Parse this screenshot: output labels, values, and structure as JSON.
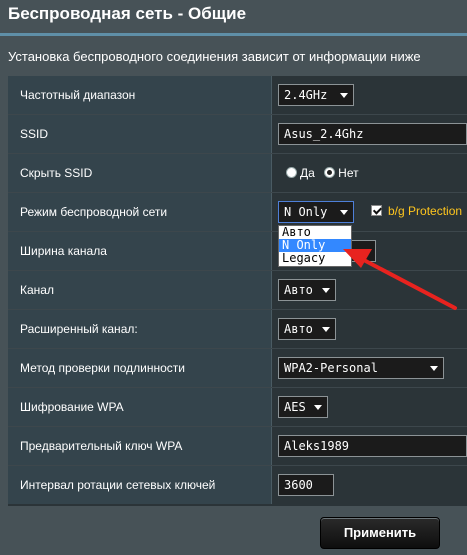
{
  "header": {
    "title": "Беспроводная сеть - Общие",
    "subtitle": "Установка беспроводного соединения зависит от информации ниже"
  },
  "rows": {
    "band": {
      "label": "Частотный диапазон",
      "value": "2.4GHz"
    },
    "ssid": {
      "label": "SSID",
      "value": "Asus_2.4Ghz"
    },
    "hide_ssid": {
      "label": "Скрыть SSID",
      "yes": "Да",
      "no": "Нет",
      "selected": "no"
    },
    "mode": {
      "label": "Режим беспроводной сети",
      "value": "N Only",
      "protection_label": "b/g Protection",
      "protection_checked": true
    },
    "width": {
      "label": "Ширина канала"
    },
    "channel": {
      "label": "Канал",
      "value": "Авто"
    },
    "ext_channel": {
      "label": "Расширенный канал:",
      "value": "Авто"
    },
    "auth": {
      "label": "Метод проверки подлинности",
      "value": "WPA2-Personal"
    },
    "encryption": {
      "label": "Шифрование WPA",
      "value": "AES"
    },
    "psk": {
      "label": "Предварительный ключ WPA",
      "value": "Aleks1989"
    },
    "rotation": {
      "label": "Интервал ротации сетевых ключей",
      "value": "3600"
    }
  },
  "mode_dropdown": {
    "options": [
      "Авто",
      "N Only",
      "Legacy"
    ],
    "highlighted": "N Only"
  },
  "apply_label": "Применить",
  "colors": {
    "background": "#475257",
    "accent": "#ffc61e",
    "highlight": "#3388ff",
    "annotation_arrow": "#e8231f"
  }
}
